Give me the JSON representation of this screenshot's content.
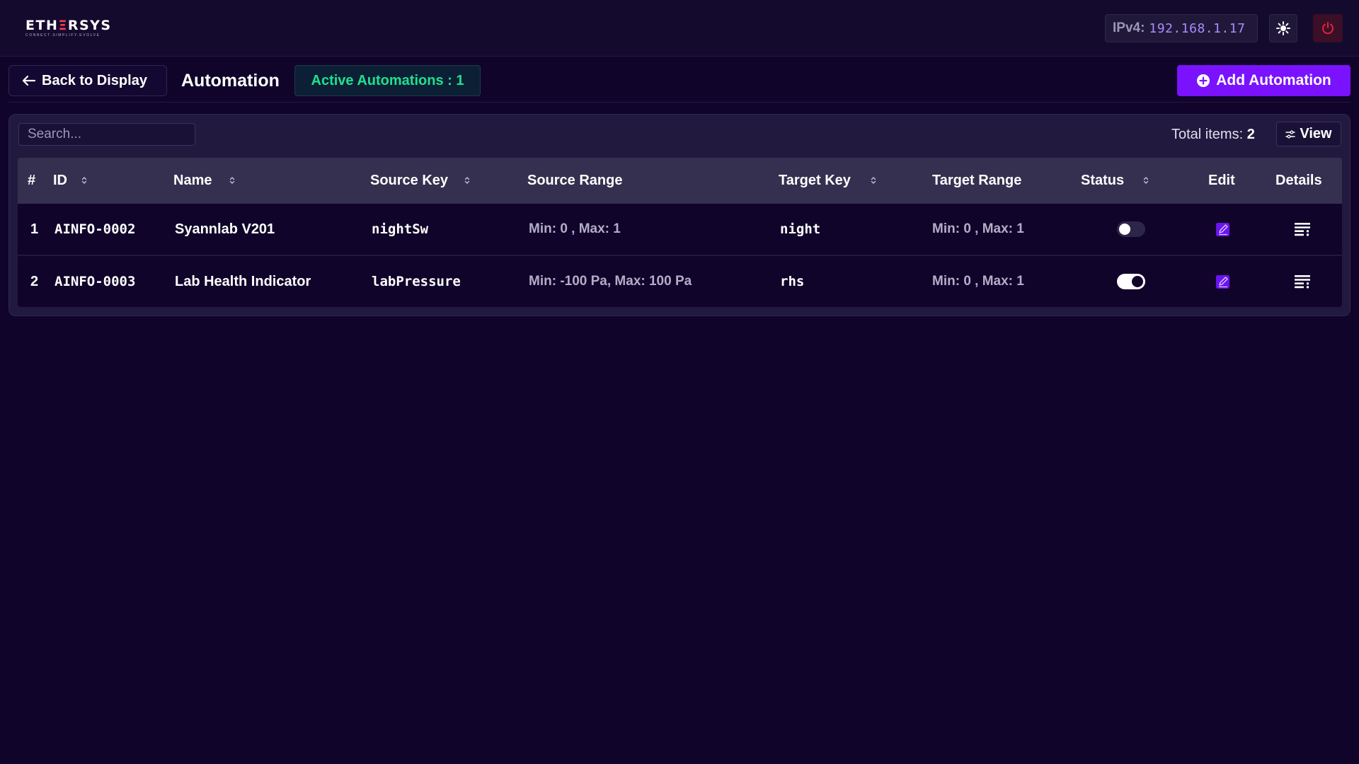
{
  "brand": {
    "logo_text_pre": "ETH",
    "logo_text_mark": "Ξ",
    "logo_text_post": "RSYS",
    "logo_tagline": "CONNECT.SIMPLIFY.EVOLVE"
  },
  "topbar": {
    "ip_label": "IPv4:",
    "ip_value": "192.168.1.17"
  },
  "header": {
    "back_label": "Back to Display",
    "title": "Automation",
    "active_label": "Active Automations : 1",
    "add_label": "Add Automation"
  },
  "toolbar": {
    "search_placeholder": "Search...",
    "total_label": "Total items:",
    "total_value": "2",
    "view_label": "View"
  },
  "table": {
    "columns": {
      "index": "#",
      "id": "ID",
      "name": "Name",
      "source_key": "Source Key",
      "source_range": "Source Range",
      "target_key": "Target Key",
      "target_range": "Target Range",
      "status": "Status",
      "edit": "Edit",
      "details": "Details"
    },
    "rows": [
      {
        "index": "1",
        "id": "AINFO-0002",
        "name": "Syannlab V201",
        "source_key": "nightSw",
        "source_range": "Min: 0 , Max: 1",
        "target_key": "night",
        "target_range": "Min: 0 , Max: 1",
        "status_on": false
      },
      {
        "index": "2",
        "id": "AINFO-0003",
        "name": "Lab Health Indicator",
        "source_key": "labPressure",
        "source_range": "Min: -100 Pa, Max: 100 Pa",
        "target_key": "rhs",
        "target_range": "Min: 0 , Max: 1",
        "status_on": true
      }
    ]
  },
  "colors": {
    "background": "#10042a",
    "accent": "#7a12ff",
    "active_green": "#1fe08e",
    "ip_purple": "#a98bff",
    "power_red": "#e0243a"
  },
  "icons": {
    "back": "arrow-left-icon",
    "theme": "sun-icon",
    "power": "power-icon",
    "add": "plus-circle-icon",
    "view": "sliders-icon",
    "sort": "sort-icon",
    "edit": "edit-icon",
    "details": "details-list-icon"
  }
}
